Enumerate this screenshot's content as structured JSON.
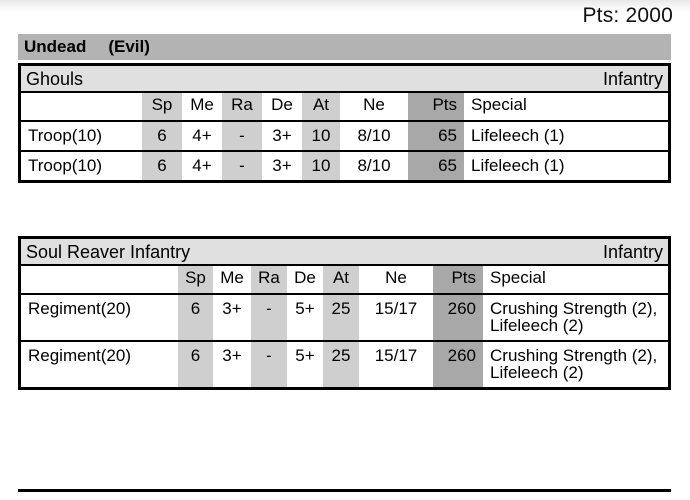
{
  "header": {
    "points_label": "Pts: 2000"
  },
  "army": {
    "name": "Undead",
    "alignment": "(Evil)"
  },
  "columns": [
    "",
    "Sp",
    "Me",
    "Ra",
    "De",
    "At",
    "Ne",
    "Pts",
    "Special"
  ],
  "units": [
    {
      "name": "Ghouls",
      "type": "Infantry",
      "rows": [
        {
          "size": "Troop(10)",
          "sp": "6",
          "me": "4+",
          "ra": "-",
          "de": "3+",
          "at": "10",
          "ne": "8/10",
          "pts": "65",
          "special": "Lifeleech (1)"
        },
        {
          "size": "Troop(10)",
          "sp": "6",
          "me": "4+",
          "ra": "-",
          "de": "3+",
          "at": "10",
          "ne": "8/10",
          "pts": "65",
          "special": "Lifeleech (1)"
        }
      ]
    },
    {
      "name": "Soul Reaver Infantry",
      "type": "Infantry",
      "rows": [
        {
          "size": "Regiment(20)",
          "sp": "6",
          "me": "3+",
          "ra": "-",
          "de": "5+",
          "at": "25",
          "ne": "15/17",
          "pts": "260",
          "special": "Crushing Strength (2), Lifeleech (2)"
        },
        {
          "size": "Regiment(20)",
          "sp": "6",
          "me": "3+",
          "ra": "-",
          "de": "5+",
          "at": "25",
          "ne": "15/17",
          "pts": "260",
          "special": "Crushing Strength (2), Lifeleech (2)"
        }
      ]
    }
  ],
  "colors": {
    "banner": "#b3b3b3",
    "unit_header": "#e0e0e0",
    "shade_light": "#cfcfcf",
    "shade_dark": "#a8a8a8"
  }
}
